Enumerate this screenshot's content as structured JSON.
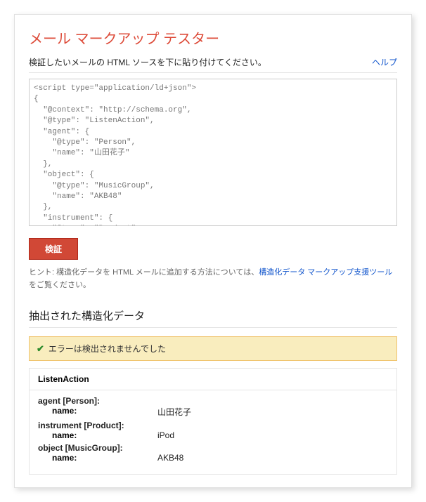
{
  "title": "メール マークアップ テスター",
  "subhead": "検証したいメールの HTML ソースを下に貼り付けてください。",
  "help_label": "ヘルプ",
  "textarea_value": "<script type=\"application/ld+json\">\n{\n  \"@context\": \"http://schema.org\",\n  \"@type\": \"ListenAction\",\n  \"agent\": {\n    \"@type\": \"Person\",\n    \"name\": \"山田花子\"\n  },\n  \"object\": {\n    \"@type\": \"MusicGroup\",\n    \"name\": \"AKB48\"\n  },\n  \"instrument\": {\n    \"@type\": \"Product\",\n    \"name\": \"iPod\"\n  }\n}",
  "validate_label": "検証",
  "hint_prefix": "ヒント: 構造化データを HTML メールに追加する方法については、",
  "hint_link": "構造化データ マークアップ支援ツール",
  "hint_suffix": "をご覧ください。",
  "results_heading": "抽出された構造化データ",
  "success_message": "エラーは検出されませんでした",
  "result": {
    "type": "ListenAction",
    "groups": [
      {
        "label": "agent [Person]:",
        "name_key": "name:",
        "name_val": "山田花子"
      },
      {
        "label": "instrument [Product]:",
        "name_key": "name:",
        "name_val": "iPod"
      },
      {
        "label": "object [MusicGroup]:",
        "name_key": "name:",
        "name_val": "AKB48"
      }
    ]
  }
}
